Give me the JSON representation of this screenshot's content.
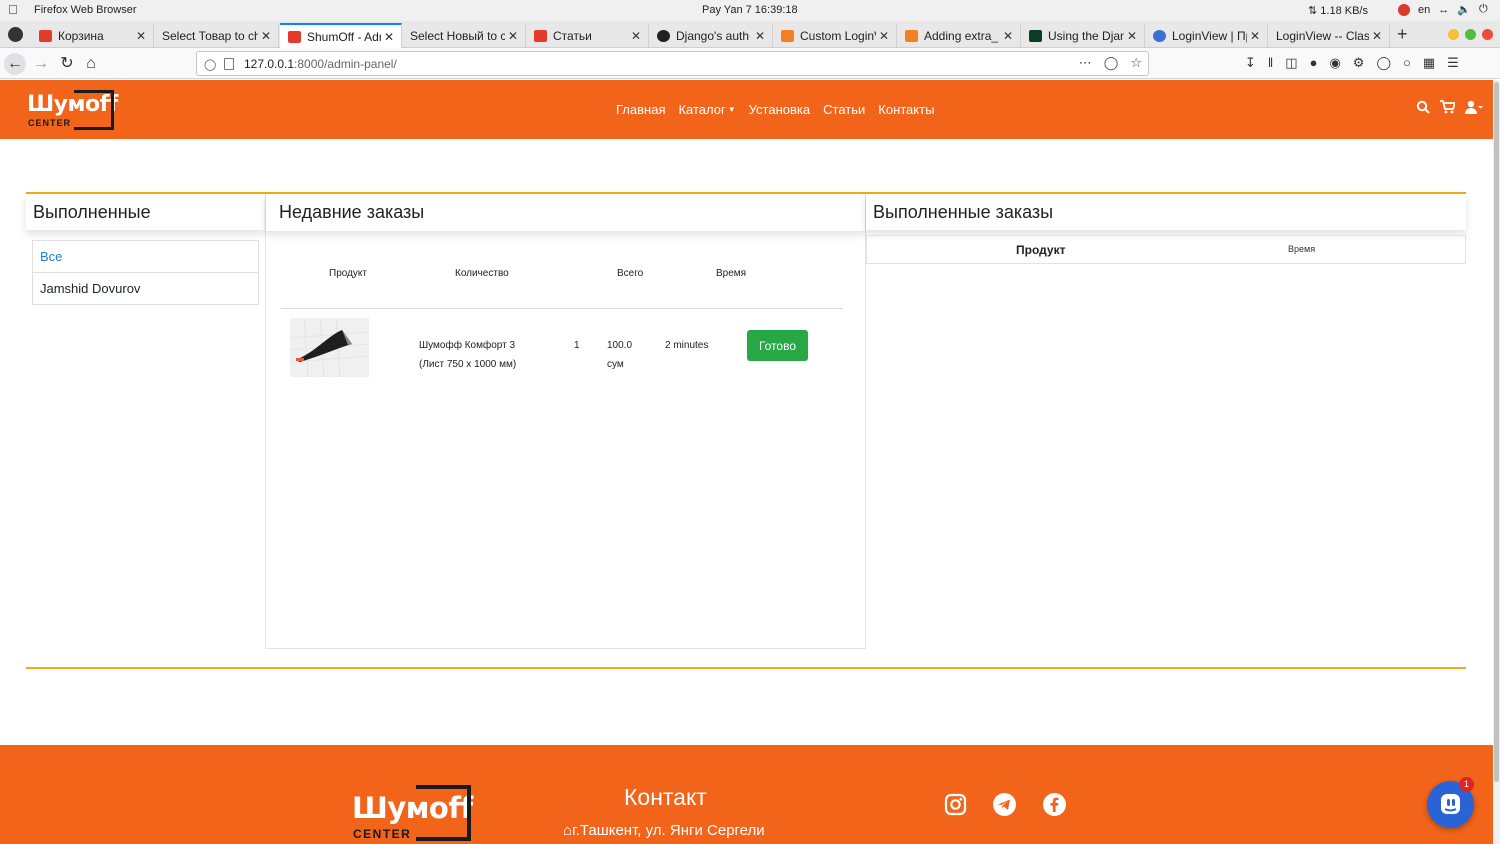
{
  "os": {
    "app_name": "Firefox Web Browser",
    "clock": "Pay Yan 7  16:39:18",
    "net_speed": "⇅ 1.18 KB/s",
    "lang": "en"
  },
  "browser": {
    "tabs": [
      {
        "label": "Корзина",
        "color": "#e53b2c"
      },
      {
        "label": "Select Товар to ch",
        "color": ""
      },
      {
        "label": "ShumOff - Adm",
        "color": "#e53b2c"
      },
      {
        "label": "Select Новый to c",
        "color": ""
      },
      {
        "label": "Статьи",
        "color": "#e53b2c"
      },
      {
        "label": "Django's auth",
        "color": "#222"
      },
      {
        "label": "Custom LoginV",
        "color": "#f48024"
      },
      {
        "label": "Adding extra_",
        "color": "#f48024"
      },
      {
        "label": "Using the Djan",
        "color": "#0c3c26"
      },
      {
        "label": "LoginView | Пр",
        "color": "#3a6fd8"
      },
      {
        "label": "LoginView -- Class",
        "color": ""
      }
    ],
    "url_host": "127.0.0.1",
    "url_rest": ":8000/admin-panel/"
  },
  "site": {
    "logo_text": "Шумoff",
    "logo_sub": "CENTER",
    "nav": [
      "Главная",
      "Каталог",
      "Установка",
      "Статьи",
      "Контакты"
    ],
    "brand_color": "#f26419"
  },
  "left_panel": {
    "title": "Выполненные",
    "filters": [
      "Все",
      "Jamshid Dovurov"
    ]
  },
  "recent_orders": {
    "title": "Недавние заказы",
    "headers": [
      "Продукт",
      "Количество",
      "Всего",
      "Время"
    ],
    "rows": [
      {
        "product_line1": "Шумофф Комфорт 3",
        "product_line2": "(Лист 750 х 1000 мм)",
        "qty": "1",
        "total_line1": "100.0",
        "total_line2": "сум",
        "time": "2 minutes",
        "action": "Готово"
      }
    ]
  },
  "done_orders": {
    "title": "Выполненные заказы",
    "headers": [
      "Продукт",
      "Время"
    ]
  },
  "footer": {
    "contact_title": "Контакт",
    "address": "г.Ташкент, ул. Янги Сергели",
    "chat_badge": "1"
  }
}
